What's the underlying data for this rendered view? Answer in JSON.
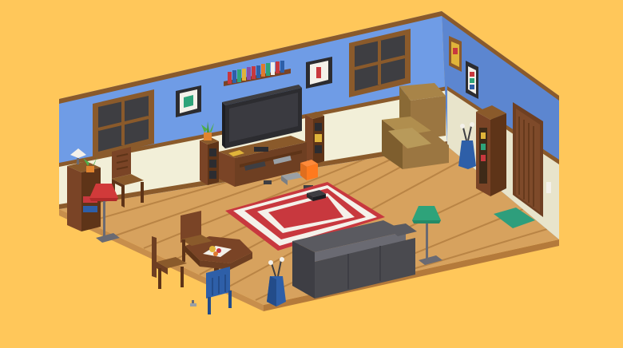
{
  "scene": {
    "kind": "isometric-voxel-room",
    "colors": {
      "background": "#FFC75A",
      "wall_blue": "#6F9CE6",
      "wall_blue_dark": "#5C86D0",
      "wainscot": "#F2EFD8",
      "trim": "#8A5A2B",
      "floor": "#D7A25E",
      "floor_line": "#B98445",
      "rug_red": "#C8383E",
      "rug_white": "#F4F1EA",
      "sofa": "#4A4A4F",
      "armchair": "#9B7641",
      "wood": "#7A4426",
      "tv": "#2C2C30",
      "lamp_red": "#D13A3A",
      "lamp_green": "#2EA37A",
      "vase_blue": "#2E5FA8",
      "doormat": "#2E9E7C"
    },
    "icons": [
      "book-icon",
      "picture-frame-icon",
      "window-icon",
      "plant-icon",
      "lamp-icon",
      "tv-icon",
      "speaker-icon",
      "vase-icon",
      "chair-icon",
      "table-icon",
      "sofa-icon",
      "armchair-icon",
      "clock-icon",
      "door-icon",
      "rug-icon",
      "gamepad-icon"
    ]
  }
}
